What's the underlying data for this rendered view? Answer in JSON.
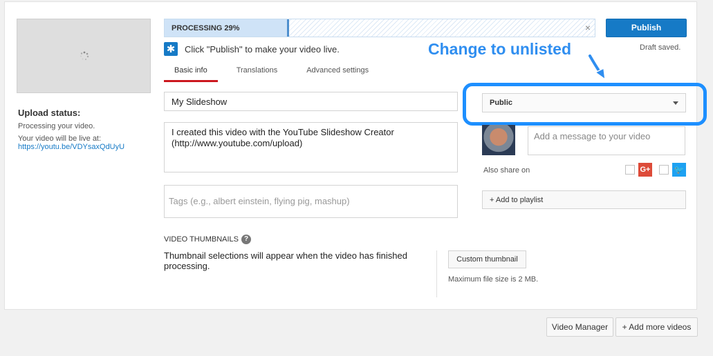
{
  "upload": {
    "status_heading": "Upload status:",
    "status_text": "Processing your video.",
    "live_label": "Your video will be live at:",
    "live_link": "https://youtu.be/VDYsaxQdUyU"
  },
  "progress": {
    "label": "PROCESSING 29%",
    "percent": 29,
    "close_glyph": "×"
  },
  "publish": {
    "label": "Publish",
    "draft": "Draft saved."
  },
  "hint": {
    "icon": "star-icon",
    "text": "Click \"Publish\" to make your video live."
  },
  "tabs": [
    {
      "label": "Basic info",
      "active": true
    },
    {
      "label": "Translations",
      "active": false
    },
    {
      "label": "Advanced settings",
      "active": false
    }
  ],
  "form": {
    "title_value": "My Slideshow",
    "description_value": "I created this video with the YouTube Slideshow Creator (http://www.youtube.com/upload)",
    "tags_placeholder": "Tags (e.g., albert einstein, flying pig, mashup)"
  },
  "privacy": {
    "selected": "Public"
  },
  "annotation": {
    "text": "Change to unlisted",
    "color": "#2f8ef0"
  },
  "share": {
    "message_placeholder": "Add a message to your video",
    "also_share": "Also share on",
    "gplus_label": "G+",
    "twitter_label": "🐦"
  },
  "playlist": {
    "label": "+ Add to playlist"
  },
  "thumbnails": {
    "heading": "VIDEO THUMBNAILS",
    "help": "?",
    "text": "Thumbnail selections will appear when the video has finished processing.",
    "custom_button": "Custom thumbnail",
    "max_size": "Maximum file size is 2 MB."
  },
  "footer": {
    "video_manager": "Video Manager",
    "add_more": "+ Add more videos"
  },
  "colors": {
    "primary": "#167ac6",
    "tab_underline": "#cc181e",
    "highlight": "#1d8fff"
  }
}
